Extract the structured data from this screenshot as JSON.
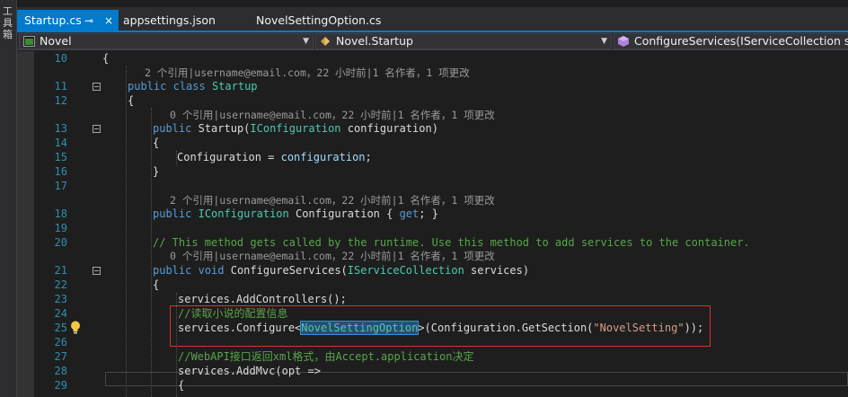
{
  "sidebar": {
    "toolbox_label": "工具箱"
  },
  "tabs": [
    {
      "label": "Startup.cs",
      "active": true,
      "pin_icon": "⊸",
      "close_icon": "×"
    },
    {
      "label": "appsettings.json",
      "active": false
    },
    {
      "label": "NovelSettingOption.cs",
      "active": false
    }
  ],
  "navbar": {
    "project": "Novel",
    "class": "Novel.Startup",
    "member": "ConfigureServices(IServiceCollection servi"
  },
  "editor": {
    "line_numbers": [
      "10",
      "11",
      "12",
      "13",
      "14",
      "15",
      "16",
      "17",
      "18",
      "19",
      "20",
      "21",
      "22",
      "23",
      "24",
      "25",
      "26",
      "27",
      "28",
      "29"
    ],
    "codelens": {
      "startup_class": "2 个引用|username@email.com，22 小时前|1 名作者，1 项更改",
      "startup_ctor": "0 个引用|username@email.com，22 小时前|1 名作者，1 项更改",
      "configuration_prop": "2 个引用|username@email.com，22 小时前|1 名作者，1 项更改",
      "configure_services": "0 个引用|username@email.com，22 小时前|1 名作者，1 项更改"
    },
    "code": {
      "l10": "{",
      "l11_kw1": "public",
      "l11_kw2": "class",
      "l11_type": "Startup",
      "l12": "{",
      "l13_kw": "public",
      "l13_name": "Startup(",
      "l13_type": "IConfiguration",
      "l13_rest": " configuration)",
      "l14": "{",
      "l15_a": "Configuration = ",
      "l15_b": "configuration",
      "l15_c": ";",
      "l16": "}",
      "l18_kw": "public",
      "l18_type": "IConfiguration",
      "l18_rest": " Configuration { ",
      "l18_get": "get",
      "l18_end": "; }",
      "l20_comment": "// This method gets called by the runtime. Use this method to add services to the container.",
      "l21_kw1": "public",
      "l21_kw2": "void",
      "l21_name": " ConfigureServices(",
      "l21_type": "IServiceCollection",
      "l21_rest": " services)",
      "l22": "{",
      "l23": "services.AddControllers();",
      "l24_comment": "//读取小说的配置信息",
      "l25_a": "services.Configure<",
      "l25_type": "NovelSettingOption",
      "l25_b": ">(Configuration.GetSection(",
      "l25_str": "\"NovelSetting\"",
      "l25_c": "));",
      "l27_comment": "//WebAPI接口返回xml格式，由Accept.application决定",
      "l28": "services.AddMvc(opt =>",
      "l29": "{"
    }
  },
  "colors": {
    "accent": "#007acc",
    "keyword": "#569cd6",
    "type": "#4ec9b0",
    "comment": "#57a64a",
    "string": "#d69d85",
    "line_number": "#2b91af",
    "annotation_box": "#e03030"
  },
  "icons": [
    "pin-icon",
    "close-icon",
    "csharp-project-icon",
    "class-icon",
    "method-icon",
    "lightbulb-icon",
    "collapse-icon"
  ]
}
